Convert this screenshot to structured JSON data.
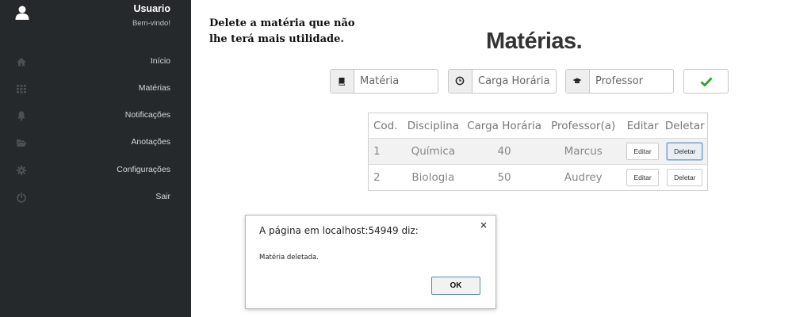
{
  "sidebar": {
    "user": {
      "name": "Usuario",
      "greeting": "Bem-vindo!"
    },
    "items": [
      {
        "label": "Início",
        "icon": "home-icon"
      },
      {
        "label": "Matérias",
        "icon": "grid-icon"
      },
      {
        "label": "Notificações",
        "icon": "bell-icon"
      },
      {
        "label": "Anotações",
        "icon": "folder-open-icon"
      },
      {
        "label": "Configurações",
        "icon": "gear-icon"
      },
      {
        "label": "Sair",
        "icon": "power-icon"
      }
    ]
  },
  "main": {
    "instruction": "Delete a matéria que não lhe terá mais utilidade.",
    "title": "Matérias.",
    "form": {
      "materia_placeholder": "Matéria",
      "carga_placeholder": "Carga Horária",
      "professor_placeholder": "Professor",
      "confirm_icon": "check-icon"
    },
    "table": {
      "headers": [
        "Cod.",
        "Disciplina",
        "Carga Horária",
        "Professor(a)",
        "Editar",
        "Deletar"
      ],
      "rows": [
        {
          "cod": "1",
          "disciplina": "Química",
          "carga": "40",
          "professor": "Marcus",
          "editar": "Editar",
          "deletar": "Deletar"
        },
        {
          "cod": "2",
          "disciplina": "Biologia",
          "carga": "50",
          "professor": "Audrey",
          "editar": "Editar",
          "deletar": "Deletar"
        }
      ]
    }
  },
  "dialog": {
    "title": "A página em localhost:54949 diz:",
    "message": "Matéria deletada.",
    "ok_label": "OK"
  },
  "colors": {
    "sidebar_bg": "#25292b",
    "check_green": "#2ea82e",
    "ok_border": "#5b87b8"
  }
}
